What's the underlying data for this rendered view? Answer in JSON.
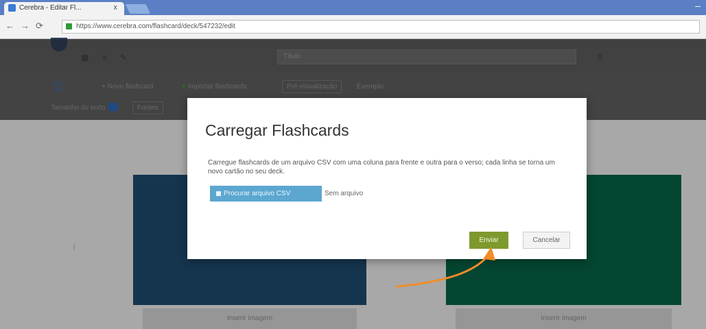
{
  "browser": {
    "tab_title": "Cerebra - Editar Fl...",
    "tab_close": "x",
    "url": "https://www.cerebra.com/flashcard/deck/547232/edit",
    "back_icon": "arrow-left",
    "forward_icon": "arrow-right",
    "reload_icon": "reload"
  },
  "app": {
    "header_tools": "▦ ≡ ✎",
    "title_placeholder": "Título",
    "header_icon": "⚲",
    "toolbar": {
      "new_flashcard": "+ Novo flashcard",
      "import_flashcards": "Importar flashcards",
      "preview": "Pré-visualização",
      "dropdown": "Exemplo"
    },
    "text_format_label": "Tamanho do texto",
    "format_dropdown": "Fontes",
    "side_marker": "⁝",
    "card_front_caption": "Inserir imagem",
    "card_back_caption": "Inserir imagem"
  },
  "modal": {
    "title": "Carregar Flashcards",
    "description": "Carregue flashcards de um arquivo CSV com uma coluna para frente e outra para o verso; cada linha se torna um novo cartão no seu deck.",
    "browse_label": "Procurar arquivo CSV",
    "no_file": "Sem arquivo",
    "load_label": "Enviar",
    "cancel_label": "Cancelar"
  },
  "colors": {
    "accent_green": "#7e9a2d",
    "button_blue": "#5ba7d0",
    "card_blue": "#1e4a6c",
    "card_green": "#066146",
    "annotation_arrow": "#f28c28"
  }
}
